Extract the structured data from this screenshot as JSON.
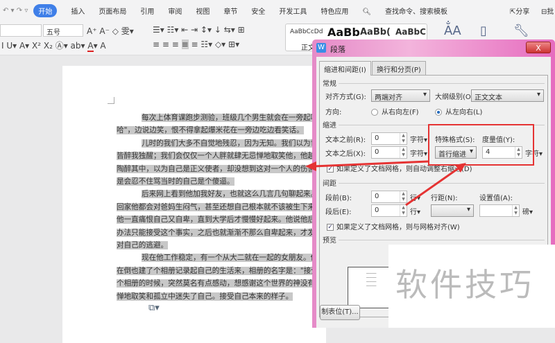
{
  "menu": {
    "tabs": [
      "开始",
      "插入",
      "页面布局",
      "引用",
      "审阅",
      "视图",
      "章节",
      "安全",
      "开发工具",
      "特色应用"
    ],
    "search": "查找命令、搜索模板",
    "share": "分享",
    "annotate": "批"
  },
  "ribbon": {
    "font_size": "五号",
    "styles": [
      "AaBbCcDd",
      "AaBb",
      "AaBb(",
      "AaBbC"
    ],
    "style_label": "正文"
  },
  "document": {
    "lines": [
      {
        "indent": true,
        "text": "每次上体育课跑步测验，班级几个男生就会在一旁起哄，大"
      },
      {
        "indent": false,
        "text": "哈\"，边说边笑，恨不得拿起爆米花在一旁边吃边看笑话。"
      },
      {
        "indent": true,
        "text": "儿时的我们大多不自觉地残忍，因为无知。我们以为世界非"
      },
      {
        "indent": false,
        "text": "皆醉我独醒；我们会仅仅一个人胖就肆无忌惮地取笑他，他越生气我们"
      },
      {
        "indent": false,
        "text": "陶醉其中，以为自己是正义使者，却没想到这对一个人的伤害有多大。"
      },
      {
        "indent": false,
        "text": "是会忍不住骂当时的自己是个傻逼。"
      },
      {
        "indent": true,
        "text": "后来网上看到他加我好友，也就这么几言几句聊起来。他还"
      },
      {
        "indent": false,
        "text": "回家他都会对爸妈生闷气，甚至还想自己根本就不该被生下来，搞得"
      },
      {
        "indent": false,
        "text": "他一直痛恨自己又自卑，直到大学后才慢慢好起来。他说他后来知道自"
      },
      {
        "indent": false,
        "text": "办法只能接受这个事实，之后也就渐渐不那么自卑起来，才发现之前一"
      },
      {
        "indent": false,
        "text": "对自己的逃避。"
      },
      {
        "indent": true,
        "text": "现在他工作稳定，有一个从大二就在一起的女朋友。他本来"
      },
      {
        "indent": false,
        "text": "在倒也建了个相册记录起自己的生活来，相册的名字是：\"接受自己本"
      },
      {
        "indent": false,
        "text": "个相册的时候，突然莫名有点感动，想感谢这个世界的神没有让一个大"
      },
      {
        "indent": false,
        "text": "惮地取笑和孤立中迷失了自己。接受自己本来的样子。"
      }
    ]
  },
  "dialog": {
    "title": "段落",
    "close": "X",
    "tabs": [
      "缩进和间距(I)",
      "换行和分页(P)"
    ],
    "general": "常规",
    "align_label": "对齐方式(G):",
    "align_value": "两端对齐",
    "outline_label": "大纲级别(O):",
    "outline_value": "正文文本",
    "direction_label": "方向:",
    "rtl": "从右向左(F)",
    "ltr": "从左向右(L)",
    "indent": "缩进",
    "before_label": "文本之前(R):",
    "before_value": "0",
    "after_label": "文本之后(X):",
    "after_value": "0",
    "unit_char": "字符▾",
    "special_label": "特殊格式(S):",
    "special_value": "首行缩进",
    "measure_label": "度量值(Y):",
    "measure_value": "4",
    "auto_indent": "如果定义了文档网格，则自动调整右缩进(D)",
    "spacing": "间距",
    "sp_before_label": "段前(B):",
    "sp_before_value": "0",
    "sp_after_label": "段后(E):",
    "sp_after_value": "0",
    "unit_line": "行▾",
    "line_spacing_label": "行距(N):",
    "set_value_label": "设置值(A):",
    "unit_pt": "磅▾",
    "grid_align": "如果定义了文档网格，则与网格对齐(W)",
    "preview": "预览",
    "tabs_button": "制表位(T)..."
  },
  "watermark": "软件技巧",
  "colors": {
    "accent": "#3f7fe8",
    "highlight": "#e53333"
  }
}
